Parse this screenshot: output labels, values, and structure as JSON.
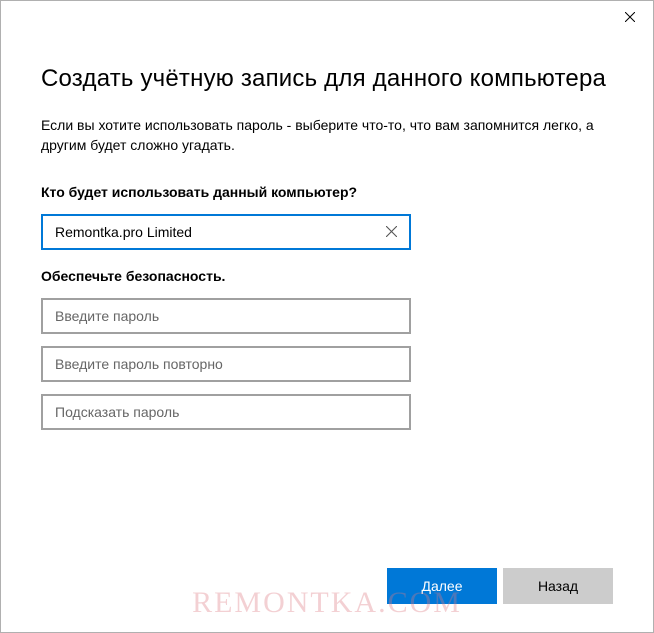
{
  "dialog": {
    "title": "Создать учётную запись для данного компьютера",
    "description": "Если вы хотите использовать пароль - выберите что-то, что вам запомнится легко, а другим будет сложно угадать."
  },
  "username_section": {
    "label": "Кто будет использовать данный компьютер?",
    "value": "Remontka.pro Limited"
  },
  "password_section": {
    "label": "Обеспечьте безопасность.",
    "password_placeholder": "Введите пароль",
    "confirm_placeholder": "Введите пароль повторно",
    "hint_placeholder": "Подсказать пароль"
  },
  "buttons": {
    "next": "Далее",
    "back": "Назад"
  },
  "watermark": "REMONTKA.COM"
}
